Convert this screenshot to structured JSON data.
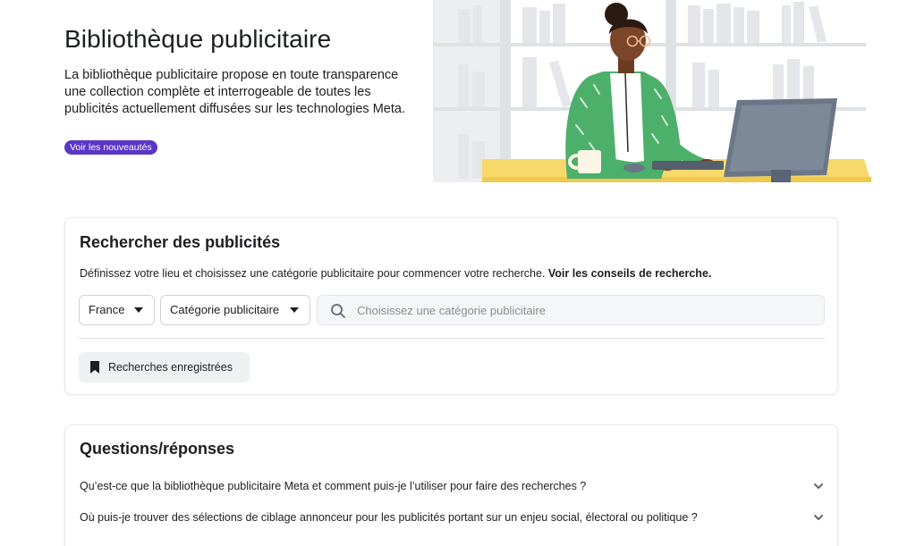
{
  "hero": {
    "title": "Bibliothèque publicitaire",
    "description": "La bibliothèque publicitaire propose en toute transparence une collection complète et interrogeable de toutes les publicités actuellement diffusées sur les technologies Meta.",
    "badge": "Voir les nouveautés"
  },
  "search": {
    "title": "Rechercher des publicités",
    "description": "Définissez votre lieu et choisissez une catégorie publicitaire pour commencer votre recherche.",
    "tips_link": "Voir les conseils de recherche.",
    "country": "France",
    "category": "Catégorie publicitaire",
    "placeholder": "Choisissez une catégorie publicitaire",
    "saved_searches": "Recherches enregistrées"
  },
  "faq": {
    "title": "Questions/réponses",
    "items": [
      "Qu’est-ce que la bibliothèque publicitaire Meta et comment puis-je l’utiliser pour faire des recherches ?",
      "Où puis-je trouver des sélections de ciblage annonceur pour les publicités portant sur un enjeu social, électoral ou politique ?"
    ]
  },
  "colors": {
    "badge": "#5b35c7",
    "sweater": "#4caf6a",
    "desk": "#f7d96b",
    "monitor": "#6b7687"
  }
}
